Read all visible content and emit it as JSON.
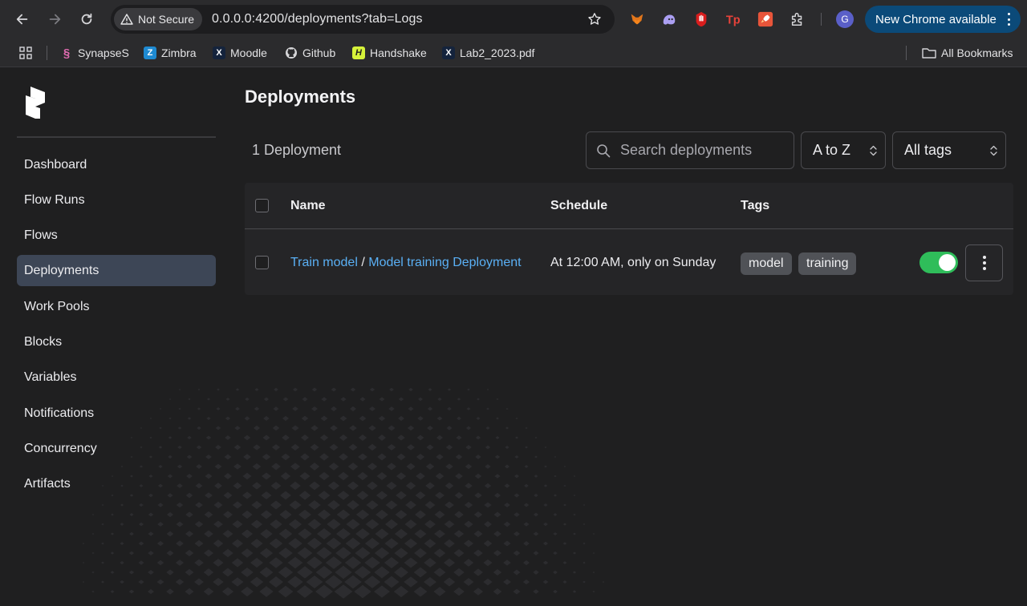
{
  "browser": {
    "security_label": "Not Secure",
    "url": "0.0.0.0:4200/deployments?tab=Logs",
    "profile_initial": "G",
    "update_label": "New Chrome available",
    "bookmarks": [
      {
        "label": "SynapseS",
        "icon": "synapse-icon"
      },
      {
        "label": "Zimbra",
        "icon": "zimbra-icon"
      },
      {
        "label": "Moodle",
        "icon": "moodle-icon"
      },
      {
        "label": "Github",
        "icon": "github-icon"
      },
      {
        "label": "Handshake",
        "icon": "handshake-icon"
      },
      {
        "label": "Lab2_2023.pdf",
        "icon": "pdf-icon"
      }
    ],
    "all_bookmarks_label": "All Bookmarks"
  },
  "sidebar": {
    "items": [
      {
        "label": "Dashboard"
      },
      {
        "label": "Flow Runs"
      },
      {
        "label": "Flows"
      },
      {
        "label": "Deployments",
        "active": true
      },
      {
        "label": "Work Pools"
      },
      {
        "label": "Blocks"
      },
      {
        "label": "Variables"
      },
      {
        "label": "Notifications"
      },
      {
        "label": "Concurrency"
      },
      {
        "label": "Artifacts"
      }
    ]
  },
  "main": {
    "title": "Deployments",
    "count_label": "1 Deployment",
    "search_placeholder": "Search deployments",
    "sort_value": "A to Z",
    "tags_value": "All tags",
    "table": {
      "headers": {
        "name": "Name",
        "schedule": "Schedule",
        "tags": "Tags"
      },
      "rows": [
        {
          "flow": "Train model",
          "separator": "/",
          "deployment": "Model training Deployment",
          "schedule": "At 12:00 AM, only on Sunday",
          "tags": [
            "model",
            "training"
          ],
          "active": true
        }
      ]
    }
  },
  "colors": {
    "accent_link": "#5ab0f5",
    "toggle_on": "#2fbd5a",
    "active_nav": "#3d4656",
    "update_button": "#0b4a79"
  }
}
